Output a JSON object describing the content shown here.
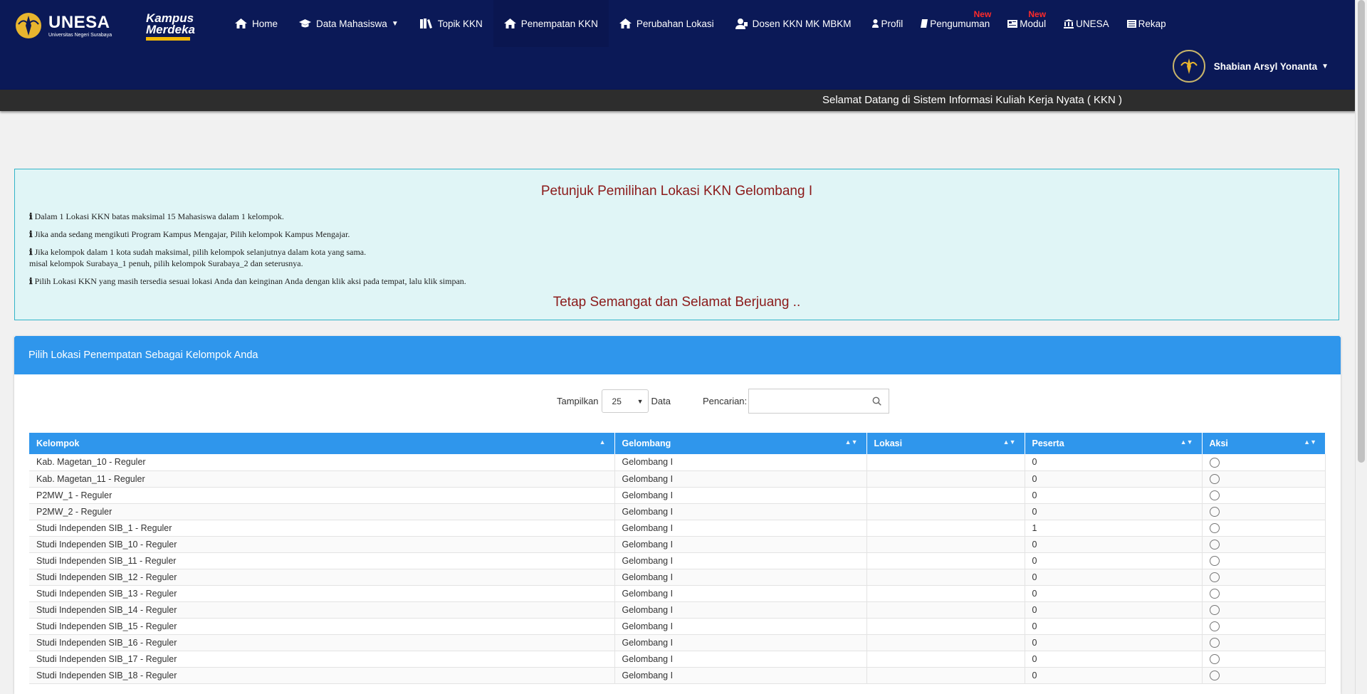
{
  "brand": {
    "name": "UNESA",
    "subtitle": "Universitas Negeri Surabaya",
    "partner_line1": "Kampus",
    "partner_line2": "Merdeka"
  },
  "nav": [
    {
      "id": "home",
      "label": "Home",
      "icon": "home-icon"
    },
    {
      "id": "data-mahasiswa",
      "label": "Data Mahasiswa",
      "icon": "graduation-cap-icon",
      "dropdown": true
    },
    {
      "id": "topik-kkn",
      "label": "Topik KKN",
      "icon": "book-icon"
    },
    {
      "id": "penempatan-kkn",
      "label": "Penempatan KKN",
      "icon": "home-icon",
      "active": true
    },
    {
      "id": "perubahan-lokasi",
      "label": "Perubahan Lokasi",
      "icon": "home-icon"
    },
    {
      "id": "dosen-kkn",
      "label": "Dosen KKN MK MBKM",
      "icon": "user-tie-icon"
    },
    {
      "id": "profil",
      "label": "Profil",
      "icon": "user-icon"
    },
    {
      "id": "pengumuman",
      "label": "Pengumuman",
      "icon": "note-icon",
      "badge": "New"
    },
    {
      "id": "modul",
      "label": "Modul",
      "icon": "newspaper-icon",
      "badge": "New"
    },
    {
      "id": "unesa",
      "label": "UNESA",
      "icon": "institution-icon"
    },
    {
      "id": "rekap",
      "label": "Rekap",
      "icon": "report-icon"
    }
  ],
  "user": {
    "name": "Shabian Arsyl Yonanta",
    "avatar_text": "UNESA"
  },
  "marquee": "Selamat Datang di Sistem Informasi Kuliah Kerja Nyata ( KKN )",
  "info": {
    "title": "Petunjuk Pemilihan Lokasi KKN Gelombang I",
    "items": [
      "Dalam 1 Lokasi KKN batas maksimal 15 Mahasiswa dalam 1 kelompok.",
      "Jika anda sedang mengikuti Program Kampus Mengajar, Pilih kelompok Kampus Mengajar.",
      "Jika kelompok dalam 1 kota sudah maksimal, pilih kelompok selanjutnya dalam kota yang sama.",
      "misal kelompok Surabaya_1 penuh, pilih kelompok Surabaya_2 dan seterusnya.",
      "Pilih Lokasi KKN yang masih tersedia sesuai lokasi Anda dan keinginan Anda dengan klik aksi pada tempat, lalu klik simpan."
    ],
    "footer": "Tetap Semangat dan Selamat Berjuang .."
  },
  "panel": {
    "title": "Pilih Lokasi Penempatan Sebagai Kelompok Anda",
    "show_label": "Tampilkan",
    "show_value": "25",
    "data_label": "Data",
    "search_label": "Pencarian:",
    "search_value": ""
  },
  "table": {
    "headers": [
      "Kelompok",
      "Gelombang",
      "Lokasi",
      "Peserta",
      "Aksi"
    ],
    "rows": [
      [
        "Kab. Magetan_10 - Reguler",
        "Gelombang I",
        "",
        "0"
      ],
      [
        "Kab. Magetan_11 - Reguler",
        "Gelombang I",
        "",
        "0"
      ],
      [
        "P2MW_1 - Reguler",
        "Gelombang I",
        "",
        "0"
      ],
      [
        "P2MW_2 - Reguler",
        "Gelombang I",
        "",
        "0"
      ],
      [
        "Studi Independen SIB_1 - Reguler",
        "Gelombang I",
        "",
        "1"
      ],
      [
        "Studi Independen SIB_10 - Reguler",
        "Gelombang I",
        "",
        "0"
      ],
      [
        "Studi Independen SIB_11 - Reguler",
        "Gelombang I",
        "",
        "0"
      ],
      [
        "Studi Independen SIB_12 - Reguler",
        "Gelombang I",
        "",
        "0"
      ],
      [
        "Studi Independen SIB_13 - Reguler",
        "Gelombang I",
        "",
        "0"
      ],
      [
        "Studi Independen SIB_14 - Reguler",
        "Gelombang I",
        "",
        "0"
      ],
      [
        "Studi Independen SIB_15 - Reguler",
        "Gelombang I",
        "",
        "0"
      ],
      [
        "Studi Independen SIB_16 - Reguler",
        "Gelombang I",
        "",
        "0"
      ],
      [
        "Studi Independen SIB_17 - Reguler",
        "Gelombang I",
        "",
        "0"
      ],
      [
        "Studi Independen SIB_18 - Reguler",
        "Gelombang I",
        "",
        "0"
      ]
    ]
  },
  "colors": {
    "navbar": "#0b1957",
    "accent": "#2f96ec",
    "badge": "#ff2a2a",
    "info_bg": "#e0f5f6",
    "info_title": "#8b1a1a"
  }
}
